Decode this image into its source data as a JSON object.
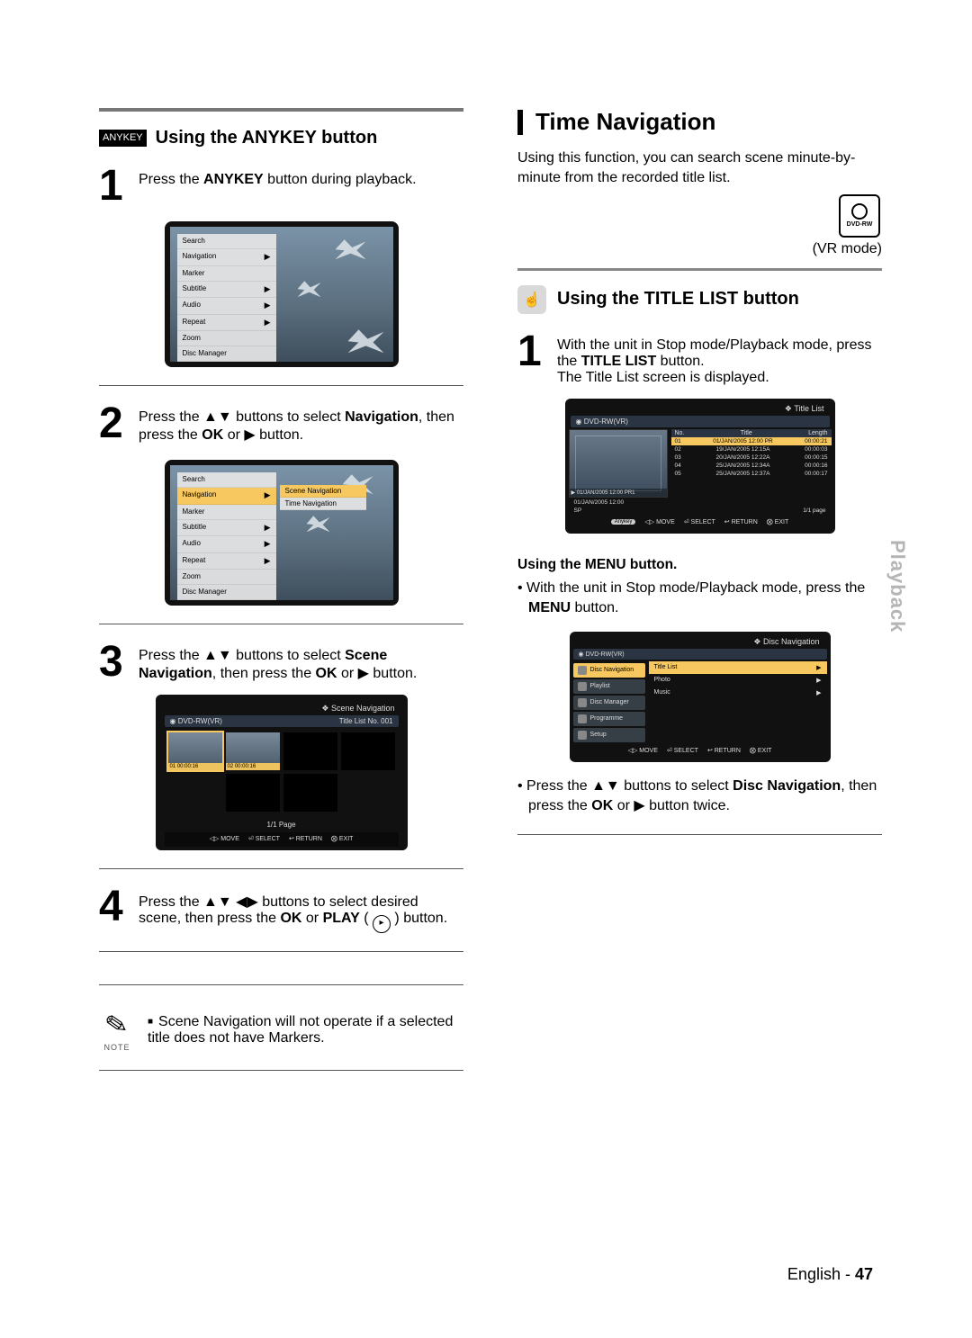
{
  "left": {
    "anykey_tag": "ANYKEY",
    "anykey_heading": "Using the ANYKEY button",
    "steps": {
      "s1": "Press the ANYKEY button during playback.",
      "s2": "Press the ▲▼ buttons to select Navigation, then press the OK or ▶ button.",
      "s3": "Press the ▲▼ buttons to select Scene Navigation, then press the OK or ▶ button.",
      "s4": "Press the ▲▼ ◀▶ buttons to select desired scene, then press the OK or PLAY (      ) button."
    },
    "osd_menu": [
      "Search",
      "Navigation",
      "Marker",
      "Subtitle",
      "Audio",
      "Repeat",
      "Zoom",
      "Disc Manager"
    ],
    "osd_submenu": [
      "Scene Navigation",
      "Time Navigation"
    ],
    "scene_nav": {
      "title": "Scene Navigation",
      "bar_left": "DVD-RW(VR)",
      "bar_right": "Title List   No. 001",
      "thumbs": [
        {
          "cap": "01  00:00:16",
          "sel": true,
          "filled": true
        },
        {
          "cap": "02  00:00:16",
          "sel": false,
          "filled": true
        },
        {
          "cap": "",
          "sel": false,
          "filled": false
        },
        {
          "cap": "",
          "sel": false,
          "filled": false
        },
        {
          "cap": "",
          "sel": false,
          "filled": false
        },
        {
          "cap": "",
          "sel": false,
          "filled": false
        }
      ],
      "page": "1/1 Page",
      "help": [
        "MOVE",
        "SELECT",
        "RETURN",
        "EXIT"
      ]
    },
    "note": "Scene Navigation will not operate if a selected title does not have Markers.",
    "note_label": "NOTE"
  },
  "right": {
    "time_nav_heading": "Time Navigation",
    "intro": "Using this function, you can search scene minute-by-minute from the recorded title list.",
    "dvd_rw": "DVD-RW",
    "vr_mode": "(VR mode)",
    "titlelist_heading": "Using the TITLE LIST button",
    "step1": "With the unit in Stop mode/Playback mode, press the TITLE LIST button.",
    "step1_line2": "The Title List screen is displayed.",
    "titlelist_box": {
      "title": "Title List",
      "bar": "DVD-RW(VR)",
      "headers": [
        "No.",
        "Title",
        "Length"
      ],
      "entries": [
        {
          "no": "01",
          "title": "01/JAN/2005 12:00 PR",
          "len": "00:00:21",
          "sel": true
        },
        {
          "no": "02",
          "title": "19/JAN/2005 12:15A",
          "len": "00:00:03",
          "sel": false
        },
        {
          "no": "03",
          "title": "20/JAN/2005 12:22A",
          "len": "00:00:15",
          "sel": false
        },
        {
          "no": "04",
          "title": "25/JAN/2005 12:34A",
          "len": "00:00:16",
          "sel": false
        },
        {
          "no": "05",
          "title": "25/JAN/2005 12:37A",
          "len": "00:00:17",
          "sel": false
        }
      ],
      "preview_cap1": "01/JAN/2005 12:00 PR1",
      "preview_cap2": "01/JAN/2005 12:00",
      "preview_cap3": "SP",
      "page": "1/1 page",
      "help": [
        "MOVE",
        "SELECT",
        "RETURN",
        "EXIT"
      ],
      "anykey": "Anykey"
    },
    "menu_sub": "Using the MENU button.",
    "menu_b1": "With the unit in Stop mode/Playback mode, press the MENU button.",
    "menu_b2": "Press the ▲▼ buttons to select Disc Navigation, then press the OK or ▶ button twice.",
    "discnav": {
      "title": "Disc Navigation",
      "bar": "DVD-RW(VR)",
      "side": [
        "Disc Navigation",
        "Playlist",
        "Disc Manager",
        "Programme",
        "Setup"
      ],
      "right": [
        "Title List",
        "Photo",
        "Music"
      ],
      "help": [
        "MOVE",
        "SELECT",
        "RETURN",
        "EXIT"
      ]
    }
  },
  "side_tab": "Playback",
  "footer_lang": "English -",
  "footer_page": "47"
}
